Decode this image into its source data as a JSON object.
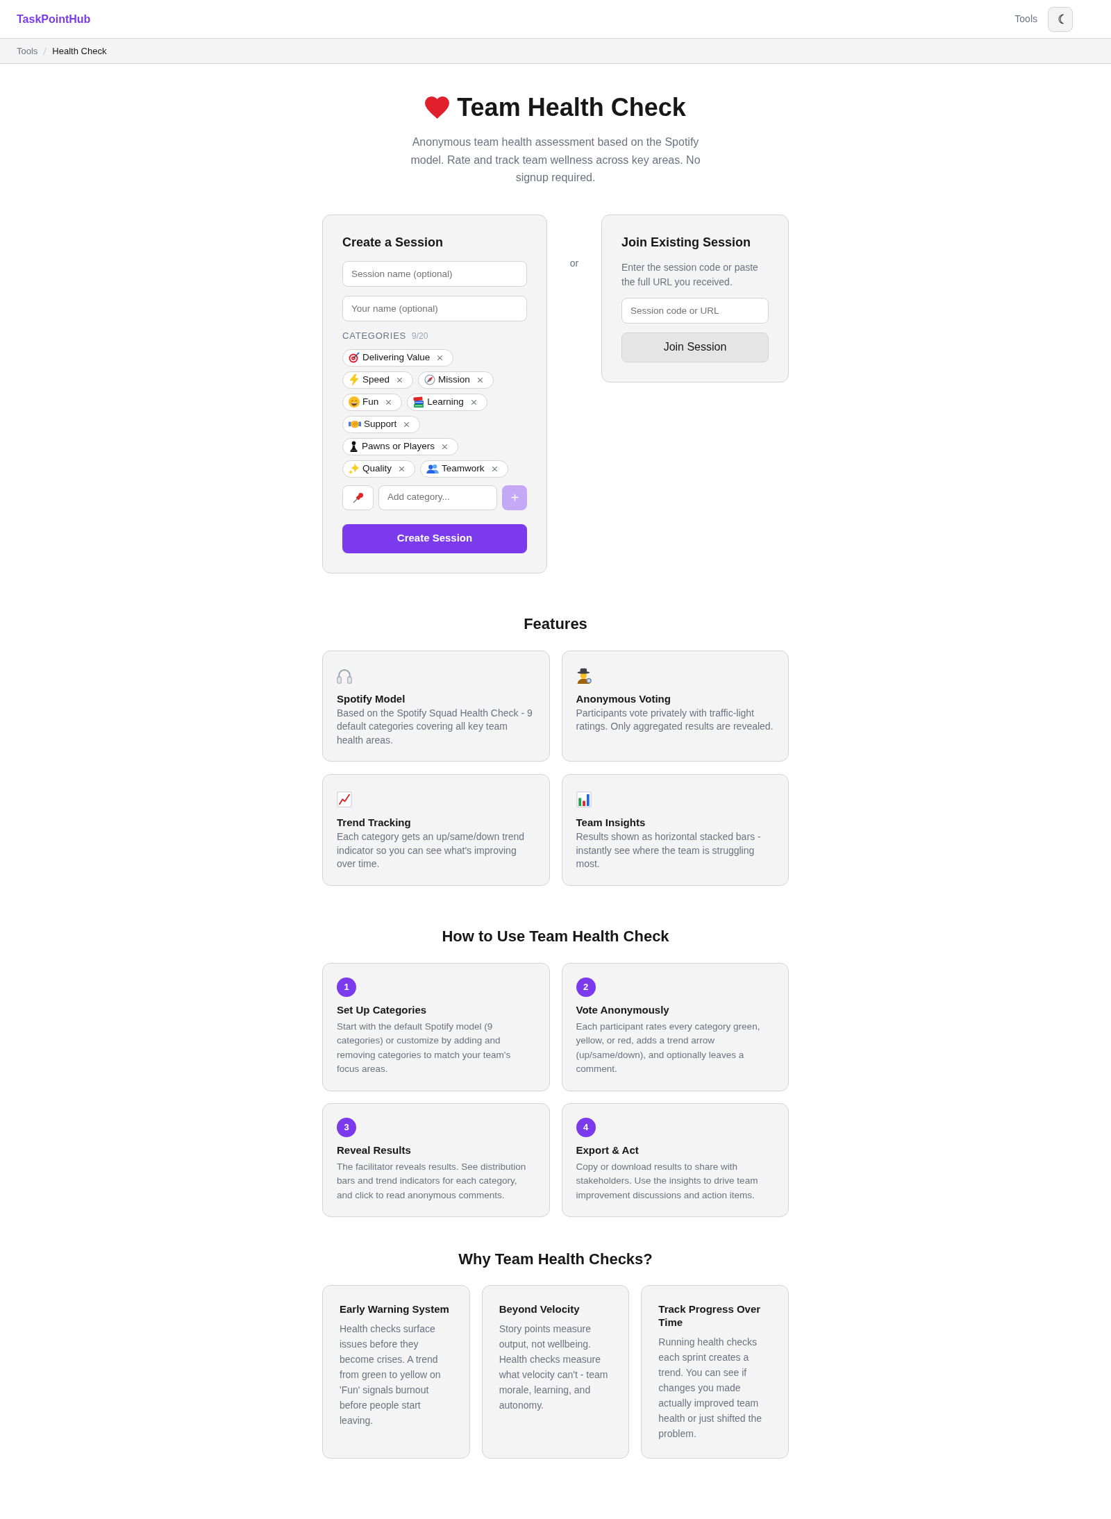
{
  "header": {
    "logo": "TaskPointHub",
    "nav_link": "Tools"
  },
  "breadcrumb": [
    {
      "label": "Tools",
      "current": false
    },
    {
      "label": "Health Check",
      "current": true
    }
  ],
  "hero": {
    "title": "Team Health Check",
    "subtitle": "Anonymous team health assessment based on the Spotify model. Rate and track team wellness across key areas. No signup required."
  },
  "create_session": {
    "title": "Create a Session",
    "fields": [
      {
        "placeholder": "Session name (optional)"
      },
      {
        "placeholder": "Your name (optional)"
      }
    ],
    "categories_label": "CATEGORIES",
    "categories_count": "9/20",
    "categories": [
      {
        "label": "Delivering Value"
      },
      {
        "label": "Speed"
      },
      {
        "label": "Mission"
      },
      {
        "label": "Fun"
      },
      {
        "label": "Learning"
      },
      {
        "label": "Support"
      },
      {
        "label": "Pawns or Players"
      },
      {
        "label": "Quality"
      },
      {
        "label": "Teamwork"
      }
    ],
    "add_category": {
      "placeholder": "Add category...",
      "add_button": {
        "disabled": true
      }
    },
    "submit_button": "Create Session"
  },
  "separator": "or",
  "join_session": {
    "title": "Join Existing Session",
    "description": "Enter the session code or paste the full URL you received.",
    "field": {
      "placeholder": "Session code or URL"
    },
    "button": "Join Session"
  },
  "features": {
    "heading": "Features",
    "items": [
      {
        "title": "Spotify Model",
        "description": "Based on the Spotify Squad Health Check - 9 default categories covering all key team health areas."
      },
      {
        "title": "Anonymous Voting",
        "description": "Participants vote privately with traffic-light ratings. Only aggregated results are revealed."
      },
      {
        "title": "Trend Tracking",
        "description": "Each category gets an up/same/down trend indicator so you can see what's improving over time."
      },
      {
        "title": "Team Insights",
        "description": "Results shown as horizontal stacked bars - instantly see where the team is struggling most."
      }
    ]
  },
  "how_to": {
    "heading": "How to Use Team Health Check",
    "steps": [
      {
        "number": "1",
        "title": "Set Up Categories",
        "description": "Start with the default Spotify model (9 categories) or customize by adding and removing categories to match your team's focus areas."
      },
      {
        "number": "2",
        "title": "Vote Anonymously",
        "description": "Each participant rates every category green, yellow, or red, adds a trend arrow (up/same/down), and optionally leaves a comment."
      },
      {
        "number": "3",
        "title": "Reveal Results",
        "description": "The facilitator reveals results. See distribution bars and trend indicators for each category, and click to read anonymous comments."
      },
      {
        "number": "4",
        "title": "Export & Act",
        "description": "Copy or download results to share with stakeholders. Use the insights to drive team improvement discussions and action items."
      }
    ]
  },
  "why": {
    "heading": "Why Team Health Checks?",
    "items": [
      {
        "title": "Early Warning System",
        "description": "Health checks surface issues before they become crises. A trend from green to yellow on 'Fun' signals burnout before people start leaving."
      },
      {
        "title": "Beyond Velocity",
        "description": "Story points measure output, not wellbeing. Health checks measure what velocity can't - team morale, learning, and autonomy."
      },
      {
        "title": "Track Progress Over Time",
        "description": "Running health checks each sprint creates a trend. You can see if changes you made actually improved team health or just shifted the problem."
      }
    ]
  }
}
